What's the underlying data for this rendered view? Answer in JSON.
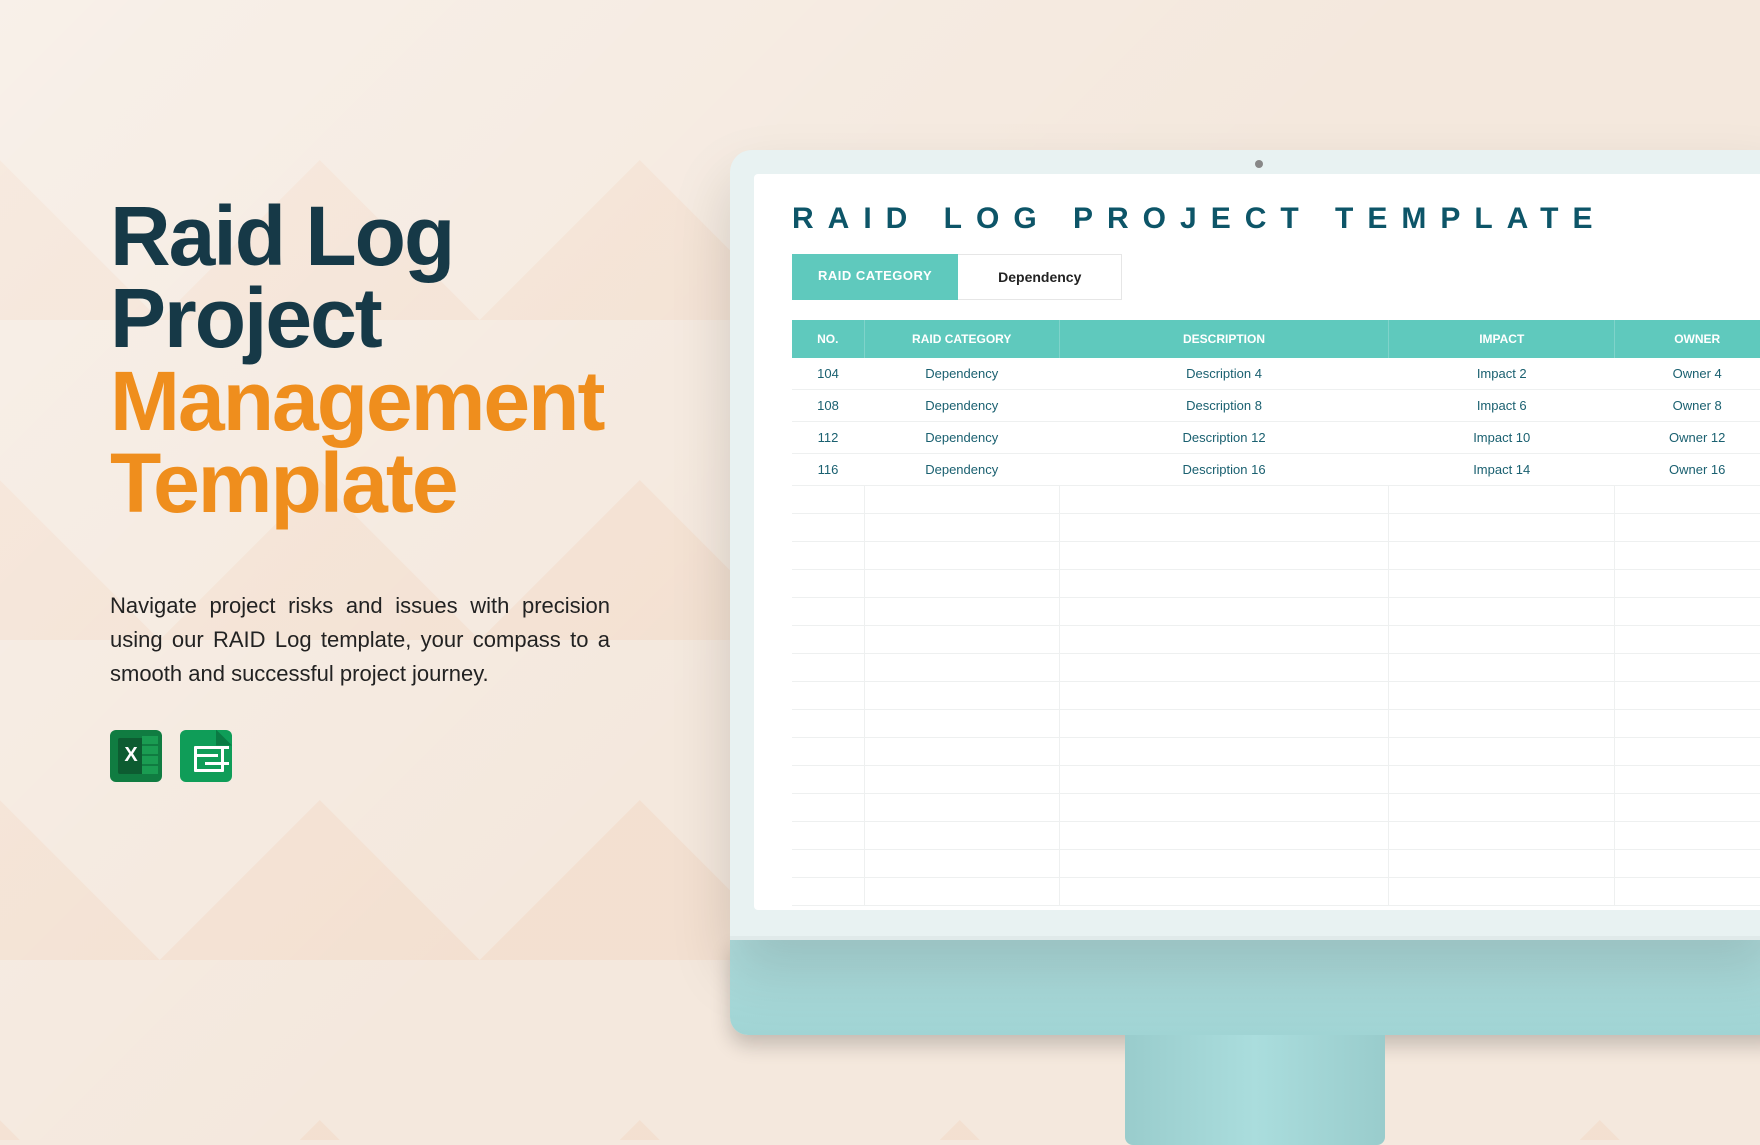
{
  "headline": {
    "line1a": "Raid Log",
    "line1b": "Project",
    "line2a": "Management",
    "line2b": "Template"
  },
  "description": "Navigate project risks and issues with precision using our RAID Log template, your compass to a smooth and successful project journey.",
  "icons": {
    "excel": "excel-icon",
    "sheets": "sheets-icon"
  },
  "screen": {
    "title": "RAID LOG PROJECT TEMPLATE",
    "tab_label": "RAID CATEGORY",
    "tab_value": "Dependency",
    "columns": [
      "NO.",
      "RAID CATEGORY",
      "DESCRIPTION",
      "IMPACT",
      "OWNER"
    ],
    "rows": [
      {
        "no": "104",
        "category": "Dependency",
        "description": "Description 4",
        "impact": "Impact 2",
        "owner": "Owner 4"
      },
      {
        "no": "108",
        "category": "Dependency",
        "description": "Description 8",
        "impact": "Impact 6",
        "owner": "Owner 8"
      },
      {
        "no": "112",
        "category": "Dependency",
        "description": "Description 12",
        "impact": "Impact 10",
        "owner": "Owner 12"
      },
      {
        "no": "116",
        "category": "Dependency",
        "description": "Description 16",
        "impact": "Impact 14",
        "owner": "Owner 16"
      }
    ]
  }
}
